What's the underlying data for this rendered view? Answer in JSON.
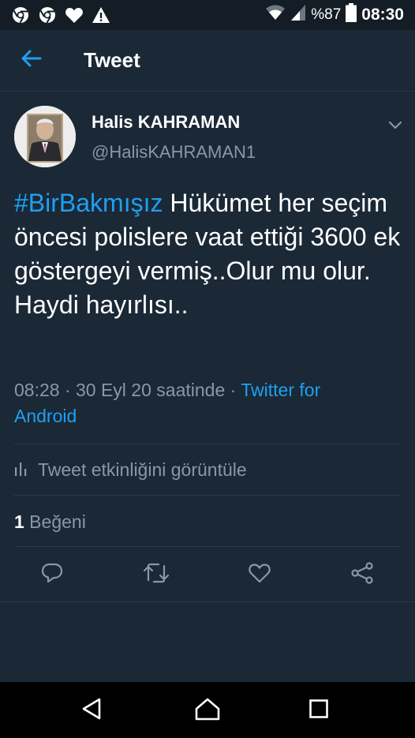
{
  "status_bar": {
    "battery_percent": "%87",
    "time": "08:30",
    "icons": [
      "chrome-icon",
      "chrome-icon",
      "heart-icon",
      "warning-icon",
      "wifi-icon",
      "signal-icon",
      "battery-icon"
    ]
  },
  "app_bar": {
    "title": "Tweet",
    "back_icon": "arrow-left-icon"
  },
  "tweet": {
    "author_name": "Halis KAHRAMAN",
    "author_handle": "@HalisKAHRAMAN1",
    "hashtag": "#BirBakmışız",
    "body": " Hükümet  her seçim öncesi polislere vaat ettiği 3600 ek göstergeyi vermiş..Olur mu olur. Haydi hayırlısı..",
    "timestamp": "08:28 · 30 Eyl 20 saatinde · ",
    "source": "Twitter for Android",
    "activity_label": "Tweet etkinliğini görüntüle",
    "likes_count": "1",
    "likes_label": " Beğeni"
  },
  "actions": [
    "reply-icon",
    "retweet-icon",
    "like-icon",
    "share-icon"
  ],
  "navbar": [
    "back-triangle-icon",
    "home-icon",
    "recents-icon"
  ],
  "colors": {
    "background": "#1b2836",
    "statusbar": "#141d26",
    "accent": "#1da1f2",
    "secondary_text": "#8899a6"
  }
}
